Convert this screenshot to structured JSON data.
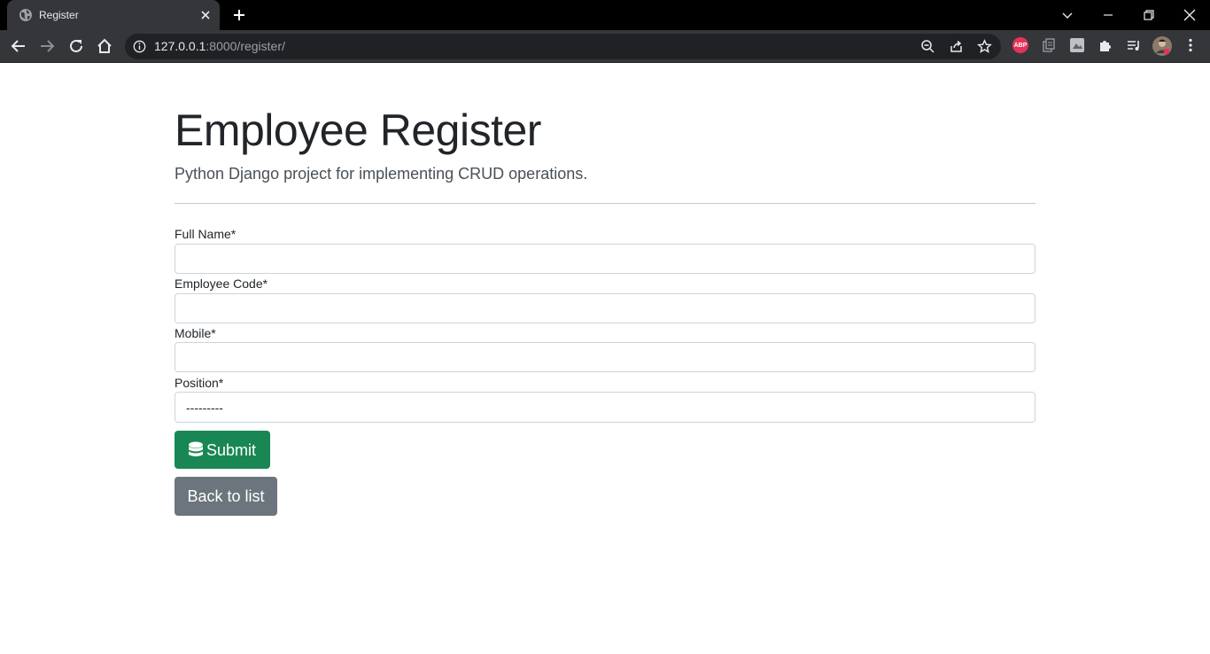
{
  "browser": {
    "tab": {
      "title": "Register",
      "favicon": "globe-icon",
      "close": "close-icon"
    },
    "new_tab": "plus-icon",
    "window_controls": [
      "tab-search-icon",
      "minimize-icon",
      "restore-icon",
      "close-icon"
    ],
    "nav": [
      "back-icon",
      "forward-icon",
      "reload-icon",
      "home-icon"
    ],
    "address": {
      "host": "127.0.0.1",
      "path": ":8000/register/"
    },
    "omnibox_actions": [
      "zoom-icon",
      "share-icon",
      "bookmark-star-icon"
    ],
    "extensions": [
      "abp-icon",
      "document-extension-icon",
      "page-extension-icon",
      "puzzle-icon",
      "media-queue-icon",
      "profile-avatar-icon",
      "menu-kebab-icon"
    ],
    "abp_label": "ABP",
    "colors": {
      "tabstrip": "#000000",
      "toolbar": "#35363a",
      "omnibox": "#202124",
      "abp": "#e4335a"
    }
  },
  "page": {
    "title": "Employee Register",
    "subtitle": "Python Django project for implementing CRUD operations.",
    "form": {
      "fields": [
        {
          "label": "Full Name*",
          "value": ""
        },
        {
          "label": "Employee Code*",
          "value": ""
        },
        {
          "label": "Mobile*",
          "value": ""
        }
      ],
      "position": {
        "label": "Position*",
        "selected": "---------"
      }
    },
    "submit_label": "Submit",
    "submit_icon": "database-icon",
    "back_label": "Back to list",
    "colors": {
      "submit": "#198754",
      "back": "#6c757d",
      "text": "#212529"
    }
  }
}
